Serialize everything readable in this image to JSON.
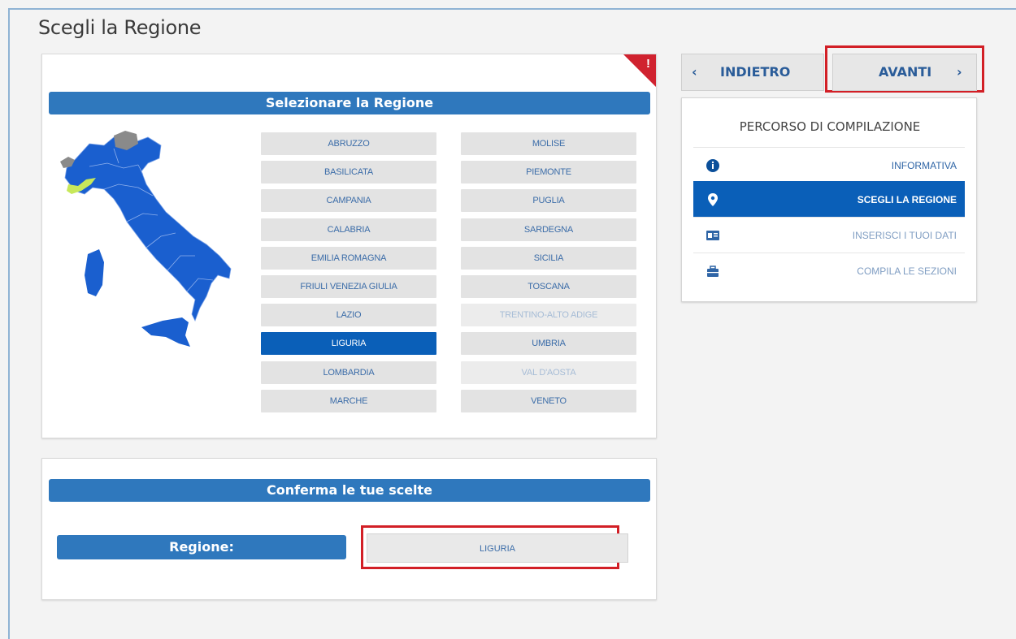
{
  "page": {
    "title": "Scegli la Regione"
  },
  "select_panel": {
    "header": "Selezionare la Regione",
    "warning_mark": "!",
    "regions_left": [
      {
        "label": "ABRUZZO",
        "state": "normal"
      },
      {
        "label": "BASILICATA",
        "state": "normal"
      },
      {
        "label": "CAMPANIA",
        "state": "normal"
      },
      {
        "label": "CALABRIA",
        "state": "normal"
      },
      {
        "label": "EMILIA ROMAGNA",
        "state": "normal"
      },
      {
        "label": "FRIULI VENEZIA GIULIA",
        "state": "normal"
      },
      {
        "label": "LAZIO",
        "state": "normal"
      },
      {
        "label": "LIGURIA",
        "state": "selected"
      },
      {
        "label": "LOMBARDIA",
        "state": "normal"
      },
      {
        "label": "MARCHE",
        "state": "normal"
      }
    ],
    "regions_right": [
      {
        "label": "MOLISE",
        "state": "normal"
      },
      {
        "label": "PIEMONTE",
        "state": "normal"
      },
      {
        "label": "PUGLIA",
        "state": "normal"
      },
      {
        "label": "SARDEGNA",
        "state": "normal"
      },
      {
        "label": "SICILIA",
        "state": "normal"
      },
      {
        "label": "TOSCANA",
        "state": "normal"
      },
      {
        "label": "TRENTINO-ALTO ADIGE",
        "state": "disabled"
      },
      {
        "label": "UMBRIA",
        "state": "normal"
      },
      {
        "label": "VAL D'AOSTA",
        "state": "disabled"
      },
      {
        "label": "VENETO",
        "state": "normal"
      }
    ],
    "map_colors": {
      "region": "#1a5fcf",
      "selected": "#c7e85a",
      "disabled": "#8a8a8a"
    }
  },
  "confirm_panel": {
    "header": "Conferma le tue scelte",
    "region_label": "Regione:",
    "region_value": "LIGURIA"
  },
  "nav": {
    "back_label": "INDIETRO",
    "back_icon": "chevron-left-icon",
    "forward_label": "AVANTI",
    "forward_icon": "chevron-right-icon"
  },
  "steps": {
    "title": "PERCORSO DI COMPILAZIONE",
    "items": [
      {
        "label": "INFORMATIVA",
        "icon": "info-icon",
        "state": "normal"
      },
      {
        "label": "SCEGLI LA REGIONE",
        "icon": "location-pin-icon",
        "state": "active"
      },
      {
        "label": "INSERISCI I TUOI DATI",
        "icon": "id-card-icon",
        "state": "muted"
      },
      {
        "label": "COMPILA LE SEZIONI",
        "icon": "briefcase-icon",
        "state": "muted"
      }
    ]
  },
  "colors": {
    "primary": "#2f78bd",
    "selected": "#0a5fb8",
    "highlight_outline": "#d21f26"
  }
}
